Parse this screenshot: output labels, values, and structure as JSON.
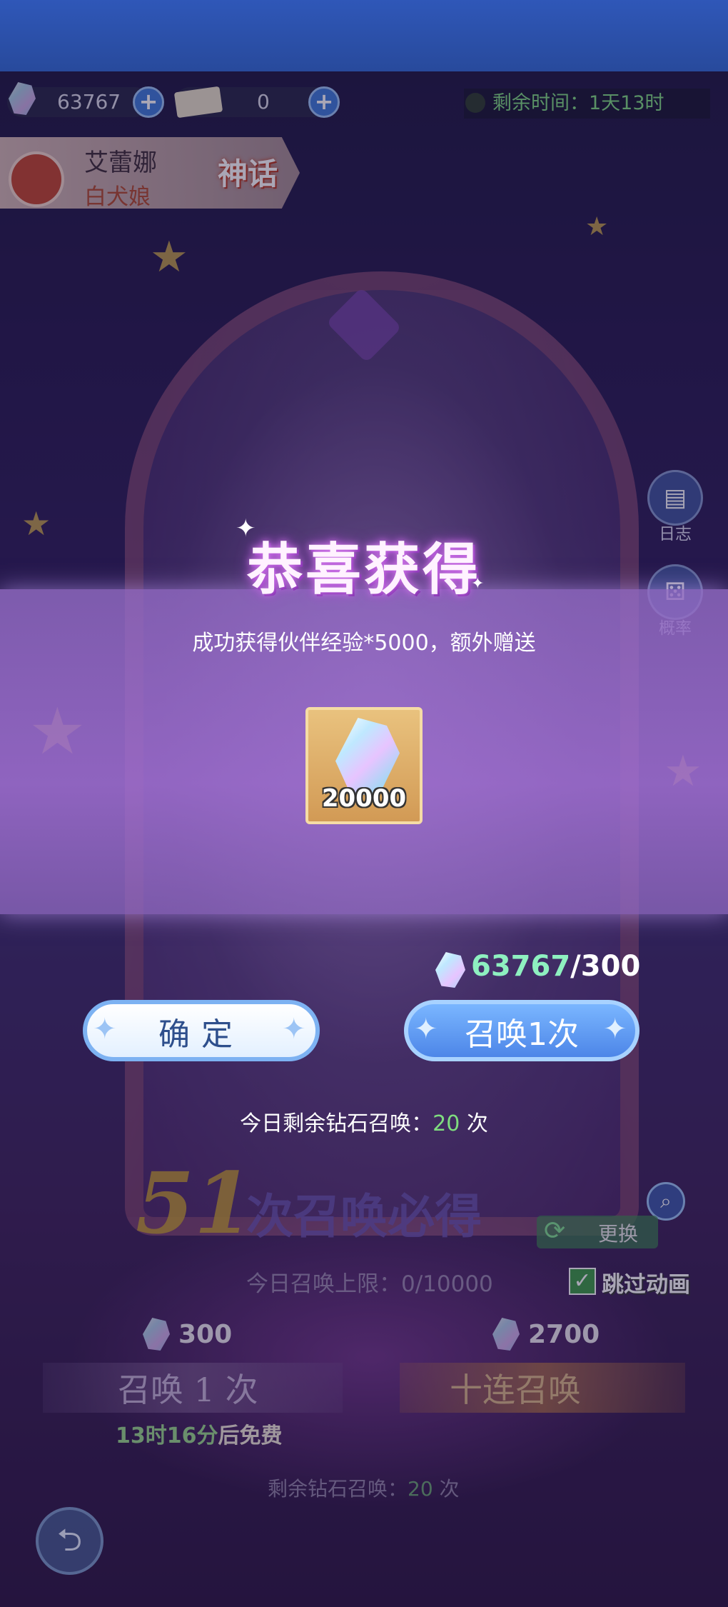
{
  "resources": {
    "diamonds": "63767",
    "tickets": "0",
    "plus_icon": "plus-icon"
  },
  "timer": {
    "text": "剩余时间：1天13时"
  },
  "character": {
    "name": "艾蕾娜",
    "subtitle": "白犬娘",
    "rarity": "神话"
  },
  "side_buttons": {
    "log": "日志",
    "rate": "概率"
  },
  "reward_dialog": {
    "title": "恭喜获得",
    "message": "成功获得伙伴经验*5000，额外赠送",
    "item_count": "20000",
    "cost_have": "63767",
    "cost_need": "/300",
    "confirm_label": "确定",
    "summon_label": "召唤1次",
    "today_prefix": "今日剩余钻石召唤：",
    "today_count": "20",
    "today_suffix": " 次"
  },
  "background_ui": {
    "guarantee_number": "51",
    "guarantee_text": "次召唤必得",
    "swap_label": "更换",
    "summon_limit": "今日召唤上限：0/10000",
    "skip_label": "跳过动画",
    "price_single": "300",
    "price_ten": "2700",
    "summon_single": "召唤 1 次",
    "summon_ten": "十连召唤",
    "free_time": "13时16分",
    "free_suffix": "后免费",
    "remaining_prefix": "剩余钻石召唤：",
    "remaining_count": "20",
    "remaining_suffix": " 次"
  },
  "colors": {
    "accent_green": "#7fdc7f",
    "button_blue": "#4d86e8",
    "panel_purple": "#a573d7"
  }
}
